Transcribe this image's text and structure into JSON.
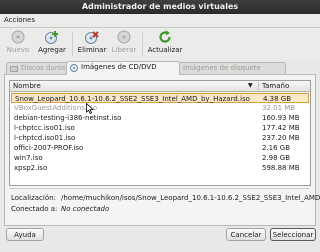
{
  "window": {
    "title": "Administrador de medios virtuales"
  },
  "menu": [
    {
      "label": "Acciones"
    }
  ],
  "toolbar": [
    {
      "label": "Nuevo",
      "icon": "new-disk-icon",
      "enabled": false
    },
    {
      "label": "Agregar",
      "icon": "add-disk-icon",
      "enabled": true
    },
    {
      "label": "Eliminar",
      "icon": "remove-disk-icon",
      "enabled": true
    },
    {
      "label": "Liberar",
      "icon": "release-disk-icon",
      "enabled": false
    },
    {
      "label": "Actualizar",
      "icon": "refresh-icon",
      "enabled": true
    }
  ],
  "tabs": [
    {
      "label": "Discos duros",
      "icon": "hard-disk-icon",
      "active": false
    },
    {
      "label": "Imágenes de CD/DVD",
      "icon": "cd-dvd-icon",
      "active": true
    },
    {
      "label": "Imágenes de disquete",
      "icon": "floppy-icon",
      "active": false
    }
  ],
  "list": {
    "columns": [
      "Nombre",
      "Tamaño"
    ],
    "rows": [
      {
        "name": "Snow_Leopard_10.6.1-10.6.2_SSE2_SSE3_Intel_AMD_by_Hazard.iso",
        "size": "4.38 GB",
        "selected": true,
        "grey": false
      },
      {
        "name": "VBoxGuestAdditions.iso",
        "size": "32.01 MB",
        "selected": false,
        "grey": true
      },
      {
        "name": "debian-testing-i386-netinst.iso",
        "size": "160.93 MB",
        "selected": false,
        "grey": false
      },
      {
        "name": "l-chptcc.iso01.iso",
        "size": "177.42 MB",
        "selected": false,
        "grey": false
      },
      {
        "name": "l-chptcd.iso01.iso",
        "size": "237.20 MB",
        "selected": false,
        "grey": false
      },
      {
        "name": "offici-2007-PROF.iso",
        "size": "2.16 GB",
        "selected": false,
        "grey": false
      },
      {
        "name": "win7.iso",
        "size": "2.98 GB",
        "selected": false,
        "grey": false
      },
      {
        "name": "xpsp2.iso",
        "size": "598.88 MB",
        "selected": false,
        "grey": false
      }
    ]
  },
  "details": {
    "location_label": "Localización:",
    "location_value": "/home/muchikon/isos/Snow_Leopard_10.6.1-10.6.2_SSE2_SSE3_Intel_AMD_b...",
    "attached_label": "Conectado a:",
    "attached_value": "No conectado"
  },
  "buttons": {
    "help": "Ayuda",
    "cancel": "Cancelar",
    "select": "Seleccionar"
  },
  "colors": {
    "titlebar": "#2f2f2e",
    "selection": "#fbe7c6",
    "accent_green": "#3f9a2b",
    "accent_red": "#c03a2b"
  }
}
